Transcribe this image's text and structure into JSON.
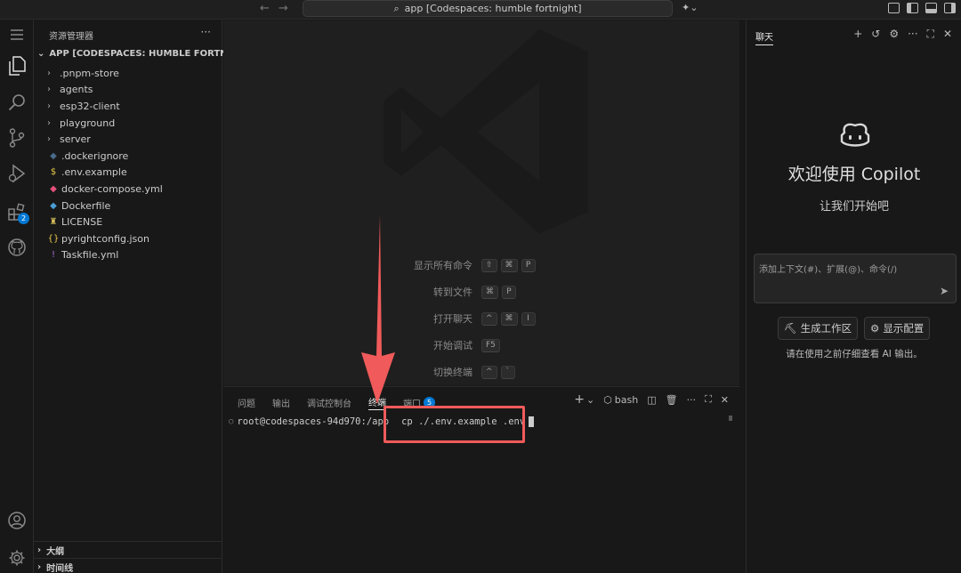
{
  "titlebar": {
    "search_text": "app [Codespaces: humble fortnight]"
  },
  "activity": {
    "extensions_badge": "2"
  },
  "sidebar": {
    "title": "资源管理器",
    "root": "APP [CODESPACES: HUMBLE FORTNIG...",
    "items": [
      {
        "label": ".pnpm-store",
        "type": "folder"
      },
      {
        "label": "agents",
        "type": "folder"
      },
      {
        "label": "esp32-client",
        "type": "folder"
      },
      {
        "label": "playground",
        "type": "folder"
      },
      {
        "label": "server",
        "type": "folder"
      },
      {
        "label": ".dockerignore",
        "type": "docker-file",
        "icon_color": "#4a6a8a"
      },
      {
        "label": ".env.example",
        "type": "env-file",
        "icon_color": "#e8c94a"
      },
      {
        "label": "docker-compose.yml",
        "type": "compose-file",
        "icon_color": "#e5507a"
      },
      {
        "label": "Dockerfile",
        "type": "docker-file",
        "icon_color": "#4a9fd8"
      },
      {
        "label": "LICENSE",
        "type": "license-file",
        "icon_color": "#d8c05a"
      },
      {
        "label": "pyrightconfig.json",
        "type": "json-file",
        "icon_color": "#e8c94a"
      },
      {
        "label": "Taskfile.yml",
        "type": "yml-file",
        "icon_color": "#a970d8"
      }
    ],
    "outline": "大纲",
    "timeline": "时间线"
  },
  "editor": {
    "shortcuts": [
      {
        "label": "显示所有命令",
        "keys": [
          "⇧",
          "⌘",
          "P"
        ]
      },
      {
        "label": "转到文件",
        "keys": [
          "⌘",
          "P"
        ]
      },
      {
        "label": "打开聊天",
        "keys": [
          "^",
          "⌘",
          "I"
        ]
      },
      {
        "label": "开始调试",
        "keys": [
          "F5"
        ]
      },
      {
        "label": "切换终端",
        "keys": [
          "^",
          "`"
        ]
      }
    ]
  },
  "panel": {
    "tabs": {
      "problems": "问题",
      "output": "输出",
      "debug_console": "调试控制台",
      "terminal": "终端",
      "ports": "端口"
    },
    "ports_badge": "5",
    "shell": "bash",
    "prompt": "root@codespaces-94d970:/app",
    "command": "cp ./.env.example .env"
  },
  "chat": {
    "tab": "聊天",
    "welcome": "欢迎使用 Copilot",
    "subtitle": "让我们开始吧",
    "input_placeholder": "添加上下文(#)、扩展(@)、命令(/)",
    "generate_workspace": "生成工作区",
    "show_config": "显示配置",
    "note": "请在使用之前仔细查看 AI 输出。"
  },
  "colors": {
    "accent": "#0078d4",
    "highlight": "#f05a5a"
  }
}
